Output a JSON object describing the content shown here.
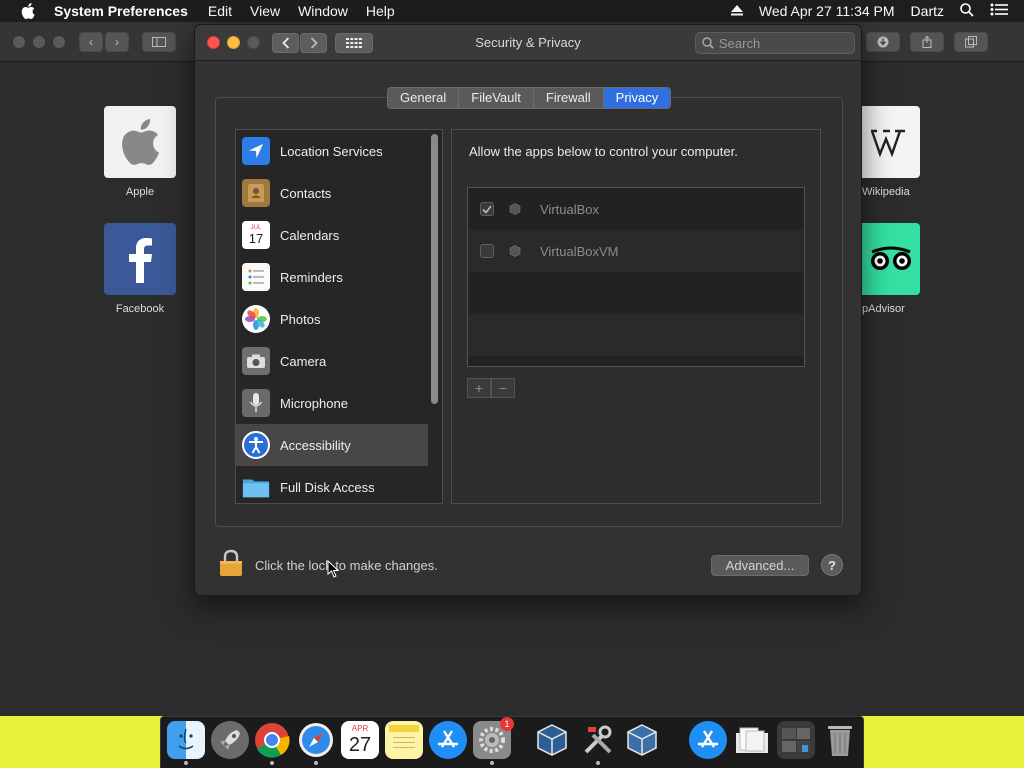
{
  "menubar": {
    "app_name": "System Preferences",
    "menus": [
      "Edit",
      "View",
      "Window",
      "Help"
    ],
    "datetime": "Wed Apr 27  11:34 PM",
    "user": "Dartz"
  },
  "favorites": {
    "apple": "Apple",
    "facebook": "Facebook",
    "wikipedia": "Wikipedia",
    "tripadvisor": "pAdvisor"
  },
  "dialog": {
    "title": "Security & Privacy",
    "search_placeholder": "Search",
    "tabs": [
      "General",
      "FileVault",
      "Firewall",
      "Privacy"
    ],
    "active_tab": "Privacy",
    "sidebar": [
      {
        "label": "Location Services",
        "icon": "location-icon"
      },
      {
        "label": "Contacts",
        "icon": "contacts-icon"
      },
      {
        "label": "Calendars",
        "icon": "calendar-icon"
      },
      {
        "label": "Reminders",
        "icon": "reminders-icon"
      },
      {
        "label": "Photos",
        "icon": "photos-icon"
      },
      {
        "label": "Camera",
        "icon": "camera-icon"
      },
      {
        "label": "Microphone",
        "icon": "microphone-icon"
      },
      {
        "label": "Accessibility",
        "icon": "accessibility-icon"
      },
      {
        "label": "Full Disk Access",
        "icon": "folder-icon"
      }
    ],
    "selected_item": "Accessibility",
    "calendar_icon_month": "JUL",
    "calendar_icon_day": "17",
    "panel_caption": "Allow the apps below to control your computer.",
    "apps": [
      {
        "name": "VirtualBox",
        "checked": true
      },
      {
        "name": "VirtualBoxVM",
        "checked": false
      }
    ],
    "add_symbol": "+",
    "remove_symbol": "−",
    "lock_text": "Click the lock to make changes.",
    "advanced_label": "Advanced...",
    "help_label": "?"
  },
  "dock": {
    "calendar_month": "APR",
    "calendar_day": "27",
    "sysprefs_badge": "1"
  }
}
